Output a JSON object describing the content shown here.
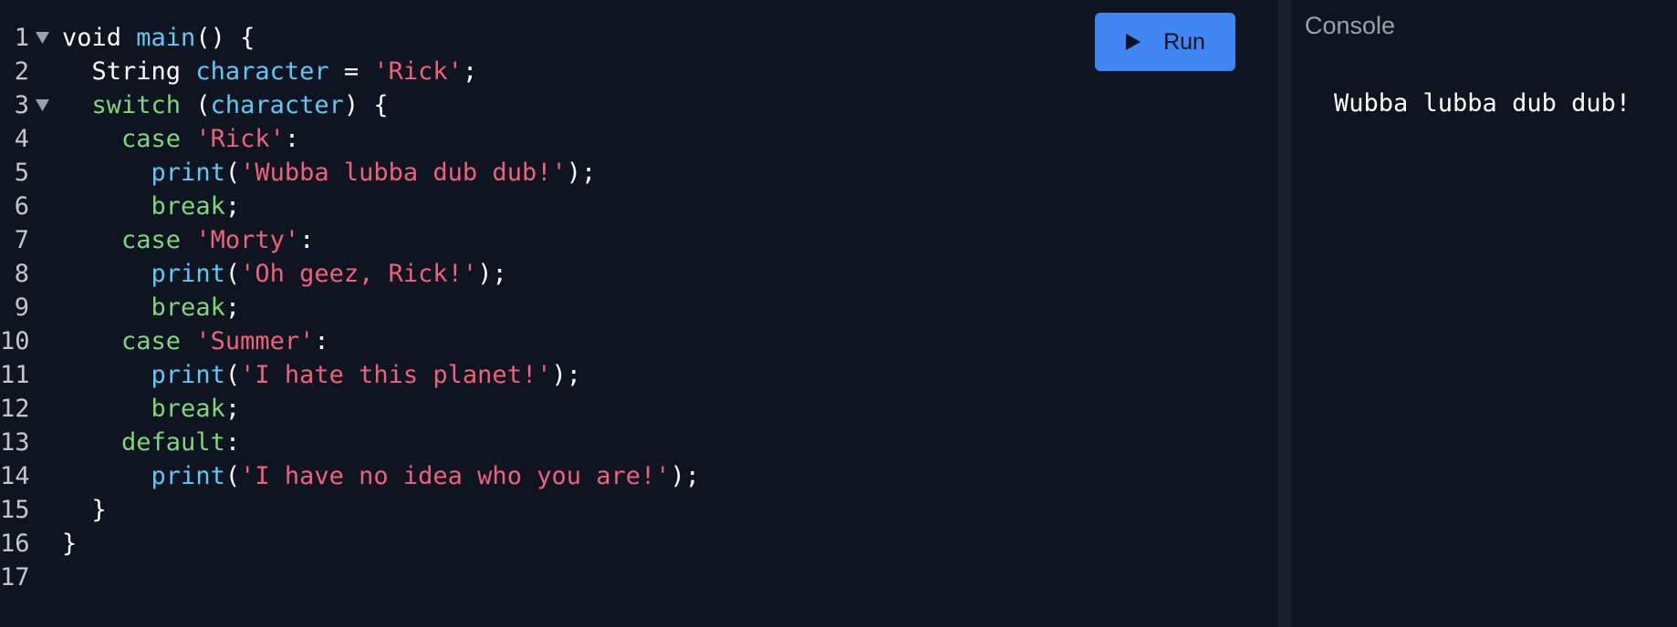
{
  "toolbar": {
    "run_label": "Run"
  },
  "console": {
    "title": "Console",
    "output": "Wubba lubba dub dub!"
  },
  "editor": {
    "lines": [
      {
        "number": "1",
        "foldable": true,
        "indent": "",
        "tokens": [
          {
            "t": "plain",
            "v": "void "
          },
          {
            "t": "fn",
            "v": "main"
          },
          {
            "t": "plain",
            "v": "() {"
          }
        ]
      },
      {
        "number": "2",
        "foldable": false,
        "indent": "  ",
        "tokens": [
          {
            "t": "plain",
            "v": "String "
          },
          {
            "t": "fn",
            "v": "character"
          },
          {
            "t": "plain",
            "v": " = "
          },
          {
            "t": "str",
            "v": "'Rick'"
          },
          {
            "t": "plain",
            "v": ";"
          }
        ]
      },
      {
        "number": "3",
        "foldable": true,
        "indent": "  ",
        "tokens": [
          {
            "t": "kw",
            "v": "switch"
          },
          {
            "t": "plain",
            "v": " ("
          },
          {
            "t": "fn",
            "v": "character"
          },
          {
            "t": "plain",
            "v": ") {"
          }
        ]
      },
      {
        "number": "4",
        "foldable": false,
        "indent": "    ",
        "tokens": [
          {
            "t": "kw",
            "v": "case"
          },
          {
            "t": "plain",
            "v": " "
          },
          {
            "t": "str",
            "v": "'Rick'"
          },
          {
            "t": "plain",
            "v": ":"
          }
        ]
      },
      {
        "number": "5",
        "foldable": false,
        "indent": "      ",
        "tokens": [
          {
            "t": "fn",
            "v": "print"
          },
          {
            "t": "plain",
            "v": "("
          },
          {
            "t": "str",
            "v": "'Wubba lubba dub dub!'"
          },
          {
            "t": "plain",
            "v": ");"
          }
        ]
      },
      {
        "number": "6",
        "foldable": false,
        "indent": "      ",
        "tokens": [
          {
            "t": "kw",
            "v": "break"
          },
          {
            "t": "plain",
            "v": ";"
          }
        ]
      },
      {
        "number": "7",
        "foldable": false,
        "indent": "    ",
        "tokens": [
          {
            "t": "kw",
            "v": "case"
          },
          {
            "t": "plain",
            "v": " "
          },
          {
            "t": "str",
            "v": "'Morty'"
          },
          {
            "t": "plain",
            "v": ":"
          }
        ]
      },
      {
        "number": "8",
        "foldable": false,
        "indent": "      ",
        "tokens": [
          {
            "t": "fn",
            "v": "print"
          },
          {
            "t": "plain",
            "v": "("
          },
          {
            "t": "str",
            "v": "'Oh geez, Rick!'"
          },
          {
            "t": "plain",
            "v": ");"
          }
        ]
      },
      {
        "number": "9",
        "foldable": false,
        "indent": "      ",
        "tokens": [
          {
            "t": "kw",
            "v": "break"
          },
          {
            "t": "plain",
            "v": ";"
          }
        ]
      },
      {
        "number": "10",
        "foldable": false,
        "indent": "    ",
        "tokens": [
          {
            "t": "kw",
            "v": "case"
          },
          {
            "t": "plain",
            "v": " "
          },
          {
            "t": "str",
            "v": "'Summer'"
          },
          {
            "t": "plain",
            "v": ":"
          }
        ]
      },
      {
        "number": "11",
        "foldable": false,
        "indent": "      ",
        "tokens": [
          {
            "t": "fn",
            "v": "print"
          },
          {
            "t": "plain",
            "v": "("
          },
          {
            "t": "str",
            "v": "'I hate this planet!'"
          },
          {
            "t": "plain",
            "v": ");"
          }
        ]
      },
      {
        "number": "12",
        "foldable": false,
        "indent": "      ",
        "tokens": [
          {
            "t": "kw",
            "v": "break"
          },
          {
            "t": "plain",
            "v": ";"
          }
        ]
      },
      {
        "number": "13",
        "foldable": false,
        "indent": "    ",
        "tokens": [
          {
            "t": "kw",
            "v": "default"
          },
          {
            "t": "plain",
            "v": ":"
          }
        ]
      },
      {
        "number": "14",
        "foldable": false,
        "indent": "      ",
        "tokens": [
          {
            "t": "fn",
            "v": "print"
          },
          {
            "t": "plain",
            "v": "("
          },
          {
            "t": "str",
            "v": "'I have no idea who you are!'"
          },
          {
            "t": "plain",
            "v": ");"
          }
        ]
      },
      {
        "number": "15",
        "foldable": false,
        "indent": "  ",
        "tokens": [
          {
            "t": "plain",
            "v": "}"
          }
        ]
      },
      {
        "number": "16",
        "foldable": false,
        "indent": "",
        "tokens": [
          {
            "t": "plain",
            "v": "}"
          }
        ]
      },
      {
        "number": "17",
        "foldable": false,
        "indent": "",
        "tokens": []
      }
    ]
  },
  "colors": {
    "background": "#0f1520",
    "run_button": "#3f86f2",
    "function": "#5fc8f4",
    "keyword": "#7ed67e",
    "string": "#f0607d"
  },
  "icons": {
    "run": "play-icon",
    "fold": "fold-arrow-icon"
  }
}
